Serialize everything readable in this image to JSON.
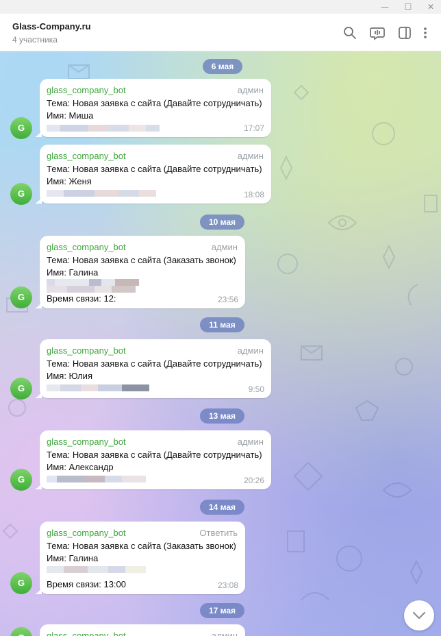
{
  "window": {
    "minimize": "—",
    "maximize": "☐",
    "close": "✕"
  },
  "header": {
    "title": "Glass-Company.ru",
    "subtitle": "4 участника"
  },
  "dates": [
    "6 мая",
    "10 мая",
    "11 мая",
    "13 мая",
    "14 мая",
    "17 мая"
  ],
  "messages": [
    {
      "sender": "glass_company_bot",
      "role": "админ",
      "avatar": "G",
      "subject": "Тема: Новая заявка с сайта (Давайте сотрудничать)",
      "name": "Имя: Миша",
      "extra": "",
      "time": "17:07"
    },
    {
      "sender": "glass_company_bot",
      "role": "админ",
      "avatar": "G",
      "subject": "Тема: Новая заявка с сайта (Давайте сотрудничать)",
      "name": "Имя: Женя",
      "extra": "",
      "time": "18:08"
    },
    {
      "sender": "glass_company_bot",
      "role": "админ",
      "avatar": "G",
      "subject": "Тема: Новая заявка с сайта (Заказать звонок)",
      "name": "Имя: Галина",
      "extra": "Время связи: 12:",
      "time": "23:56"
    },
    {
      "sender": "glass_company_bot",
      "role": "админ",
      "avatar": "G",
      "subject": "Тема: Новая заявка с сайта (Давайте сотрудничать)",
      "name": "Имя: Юлия",
      "extra": "",
      "time": "9:50"
    },
    {
      "sender": "glass_company_bot",
      "role": "админ",
      "avatar": "G",
      "subject": "Тема: Новая заявка с сайта (Давайте сотрудничать)",
      "name": "Имя: Александр",
      "extra": "",
      "time": "20:26"
    },
    {
      "sender": "glass_company_bot",
      "role": "Ответить",
      "avatar": "G",
      "subject": "Тема: Новая заявка с сайта (Заказать звонок)",
      "name": "Имя: Галина",
      "extra": "Время связи: 13:00",
      "time": "23:08"
    },
    {
      "sender": "glass_company_bot",
      "role": "админ",
      "avatar": "G",
      "subject": "",
      "name": "",
      "extra": "",
      "time": ""
    }
  ],
  "colors": {
    "accent": "#3ca63a",
    "date_pill": "#6b7dbd",
    "avatar": "#4fbe46"
  },
  "icons": [
    "search-icon",
    "voice-chat-icon",
    "sidebar-toggle-icon",
    "more-vertical-icon",
    "chevron-down-icon"
  ]
}
